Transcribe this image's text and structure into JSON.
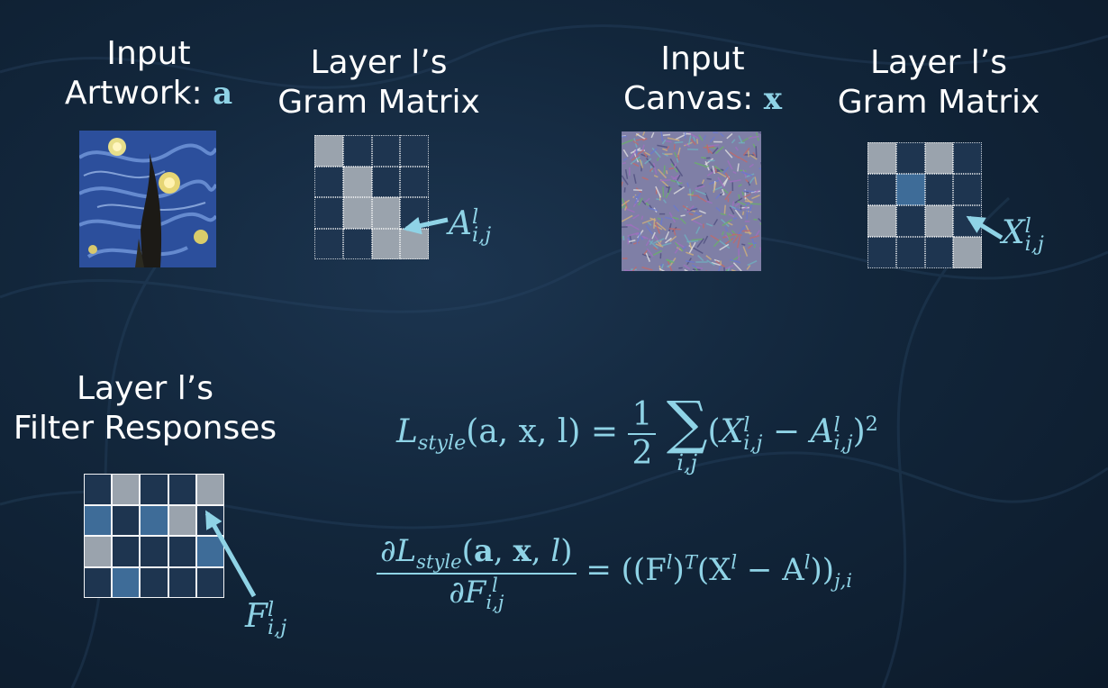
{
  "labels": {
    "input_artwork_line1": "Input",
    "input_artwork_line2": "Artwork:",
    "input_artwork_var": "a",
    "gram_a_line1": "Layer l’s",
    "gram_a_line2": "Gram Matrix",
    "input_canvas_line1": "Input",
    "input_canvas_line2": "Canvas:",
    "input_canvas_var": "x",
    "gram_x_line1": "Layer l’s",
    "gram_x_line2": "Gram Matrix",
    "filter_line1": "Layer l’s",
    "filter_line2": "Filter Responses"
  },
  "matrix_labels": {
    "A": {
      "base": "A",
      "sup": "l",
      "sub": "i,j"
    },
    "X": {
      "base": "X",
      "sup": "l",
      "sub": "i,j"
    },
    "F": {
      "base": "F",
      "sup": "l",
      "sub": "i,j"
    }
  },
  "equations": {
    "loss": "L_style(a, x, l) = 1/2 Σ_{i,j} (X^l_{i,j} − A^l_{i,j})^2",
    "gradient": "∂L_style(a, x, l) / ∂F^l_{i,j} = ((F^l)^T (X^l − A^l))_{j,i}"
  },
  "eq_parts": {
    "L": "L",
    "style": "style",
    "args": "(a, x, l) =",
    "half_num": "1",
    "half_den": "2",
    "sum": "∑",
    "sum_under": "i,j",
    "paren_open": "(",
    "minus": " − ",
    "paren_close": ")",
    "square": "2",
    "partial": "∂",
    "grad_rhs": "= ((F",
    "grad_rhs2": ")",
    "grad_T": "T",
    "grad_rhs3": "(X",
    "grad_rhs4": " − A",
    "grad_rhs5": "))",
    "grad_sub": "j,i"
  },
  "grids": {
    "gram_a": [
      [
        "light",
        "dark",
        "dark",
        "dark"
      ],
      [
        "dark",
        "light",
        "dark",
        "dark"
      ],
      [
        "dark",
        "light",
        "light",
        "dark"
      ],
      [
        "dark",
        "dark",
        "light",
        "light"
      ]
    ],
    "gram_x": [
      [
        "light",
        "dark",
        "light",
        "dark"
      ],
      [
        "dark",
        "mid",
        "dark",
        "dark"
      ],
      [
        "light",
        "dark",
        "light",
        "dark"
      ],
      [
        "dark",
        "dark",
        "dark",
        "light"
      ]
    ],
    "filter": [
      [
        "dark",
        "light",
        "dark",
        "dark",
        "light"
      ],
      [
        "mid",
        "dark",
        "mid",
        "light",
        "dark"
      ],
      [
        "light",
        "dark",
        "dark",
        "dark",
        "mid"
      ],
      [
        "dark",
        "mid",
        "dark",
        "dark",
        "dark"
      ]
    ]
  },
  "colors": {
    "accent": "#8fd3e6",
    "cell_light": "#9aa3ad",
    "cell_mid": "#3e6c98",
    "cell_dark": "#1e3550"
  }
}
